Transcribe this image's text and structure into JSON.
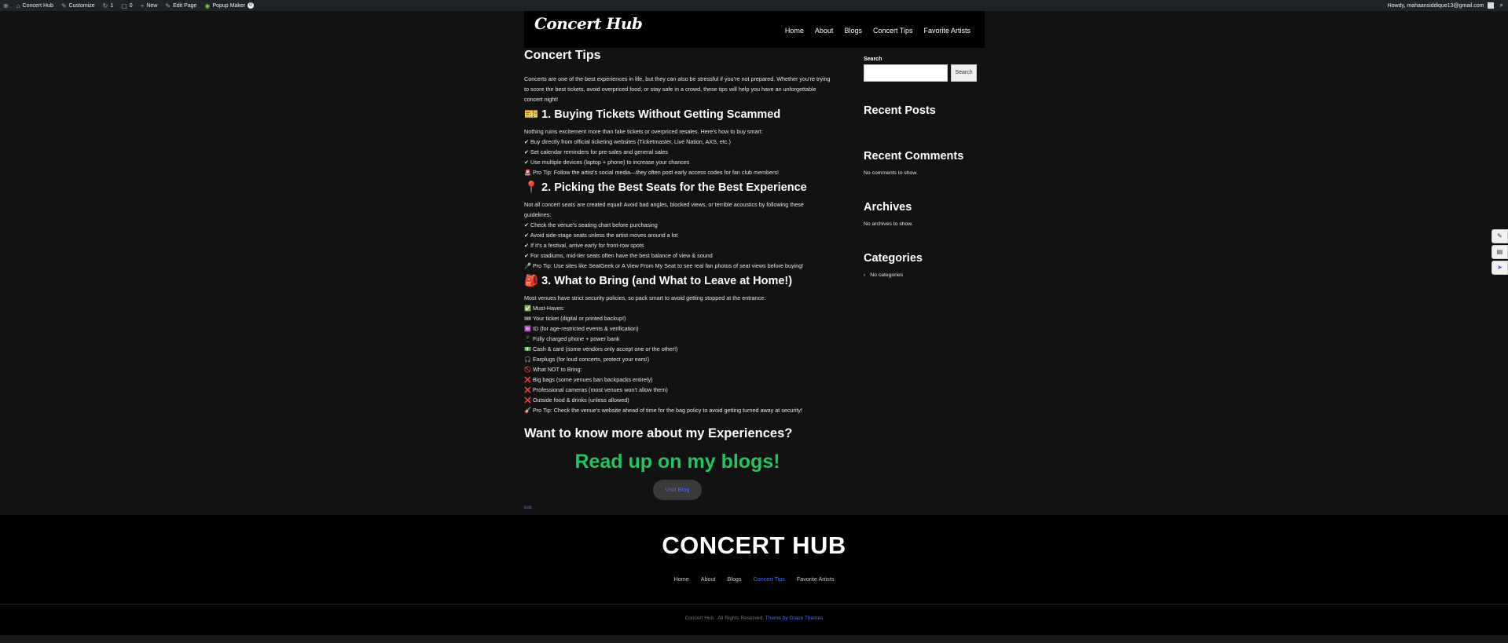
{
  "adminbar": {
    "items": [
      {
        "icon": "wordpress-icon",
        "glyph": "⊕",
        "label": ""
      },
      {
        "icon": "home-icon",
        "glyph": "⌂",
        "label": "Concert Hub"
      },
      {
        "icon": "brush-icon",
        "glyph": "✎",
        "label": "Customize"
      },
      {
        "icon": "updates-icon",
        "glyph": "↻",
        "label": "1"
      },
      {
        "icon": "comment-icon",
        "glyph": "▢",
        "label": "0"
      },
      {
        "icon": "plus-icon",
        "glyph": "+",
        "label": "New"
      },
      {
        "icon": "pencil-icon",
        "glyph": "✎",
        "label": "Edit Page"
      },
      {
        "icon": "popup-maker-icon",
        "glyph": "◉",
        "label": "Popup Maker",
        "badge": "0"
      }
    ],
    "greeting": "Howdy, mahaansiddique13@gmail.com"
  },
  "header": {
    "logo": "Concert Hub",
    "nav": [
      "Home",
      "About",
      "Blogs",
      "Concert Tips",
      "Favorite Artists"
    ]
  },
  "content": {
    "title": "Concert Tips",
    "intro": "Concerts are one of the best experiences in life, but they can also be stressful if you’re not prepared. Whether you’re trying to score the best tickets, avoid overpriced food, or stay safe in a crowd, these tips will help you have an unforgettable concert night!",
    "sections": [
      {
        "heading": "🎫 1. Buying Tickets Without Getting Scammed",
        "lead": "Nothing ruins excitement more than fake tickets or overpriced resales. Here’s how to buy smart:",
        "lines": [
          "✔ Buy directly from official ticketing websites (Ticketmaster, Live Nation, AXS, etc.)",
          "✔ Set calendar reminders for pre-sales and general sales",
          "✔ Use multiple devices (laptop + phone) to increase your chances",
          "🚨 Pro Tip: Follow the artist’s social media—they often post early access codes for fan club members!"
        ]
      },
      {
        "heading": "📍 2. Picking the Best Seats for the Best Experience",
        "lead": "Not all concert seats are created equal! Avoid bad angles, blocked views, or terrible acoustics by following these guidelines:",
        "lines": [
          "✔ Check the venue’s seating chart before purchasing",
          "✔ Avoid side-stage seats unless the artist moves around a lot",
          "✔ If it’s a festival, arrive early for front-row spots",
          "✔ For stadiums, mid-tier seats often have the best balance of view & sound",
          "🎤 Pro Tip: Use sites like SeatGeek or A View From My Seat to see real fan photos of seat views before buying!"
        ]
      },
      {
        "heading": "🎒 3. What to Bring (and What to Leave at Home!)",
        "lead": "Most venues have strict security policies, so pack smart to avoid getting stopped at the entrance:",
        "lines": [
          "✅ Must-Haves:",
          "🎟 Your ticket (digital or printed backup!)",
          "🆔 ID (for age-restricted events & verification)",
          "📱 Fully charged phone + power bank",
          "💵 Cash & card (some vendors only accept one or the other!)",
          "🎧 Earplugs (for loud concerts, protect your ears!)",
          "🚫 What NOT to Bring:",
          "❌ Big bags (some venues ban backpacks entirely)",
          "❌ Professional cameras (most venues won’t allow them)",
          "❌ Outside food & drinks (unless allowed)",
          "🎸 Pro Tip: Check the venue’s website ahead of time for the bag policy to avoid getting turned away at security!"
        ]
      }
    ],
    "more_heading": "Want to know more about my Experiences?",
    "blogs_cta": "Read up on my blogs!",
    "visit_button": "Visit Blog",
    "edit_link": "Edit"
  },
  "sidebar": {
    "search_label": "Search",
    "search_value": "",
    "search_button": "Search",
    "recent_posts": "Recent Posts",
    "recent_comments": "Recent Comments",
    "no_comments": "No comments to show.",
    "archives": "Archives",
    "no_archives": "No archives to show.",
    "categories": "Categories",
    "no_categories": "No categories"
  },
  "footer": {
    "logo": "CONCERT HUB",
    "nav": [
      "Home",
      "About",
      "Blogs",
      "Concert Tips",
      "Favorite Artists"
    ],
    "active_nav": "Concert Tips",
    "copyright": "Concert Hub . All Rights Reserved.",
    "theme_credit": "Theme by Grace Themes"
  },
  "colors": {
    "accent_green": "#22c55e",
    "link_purple": "#5a6cf0",
    "background": "#121212"
  }
}
